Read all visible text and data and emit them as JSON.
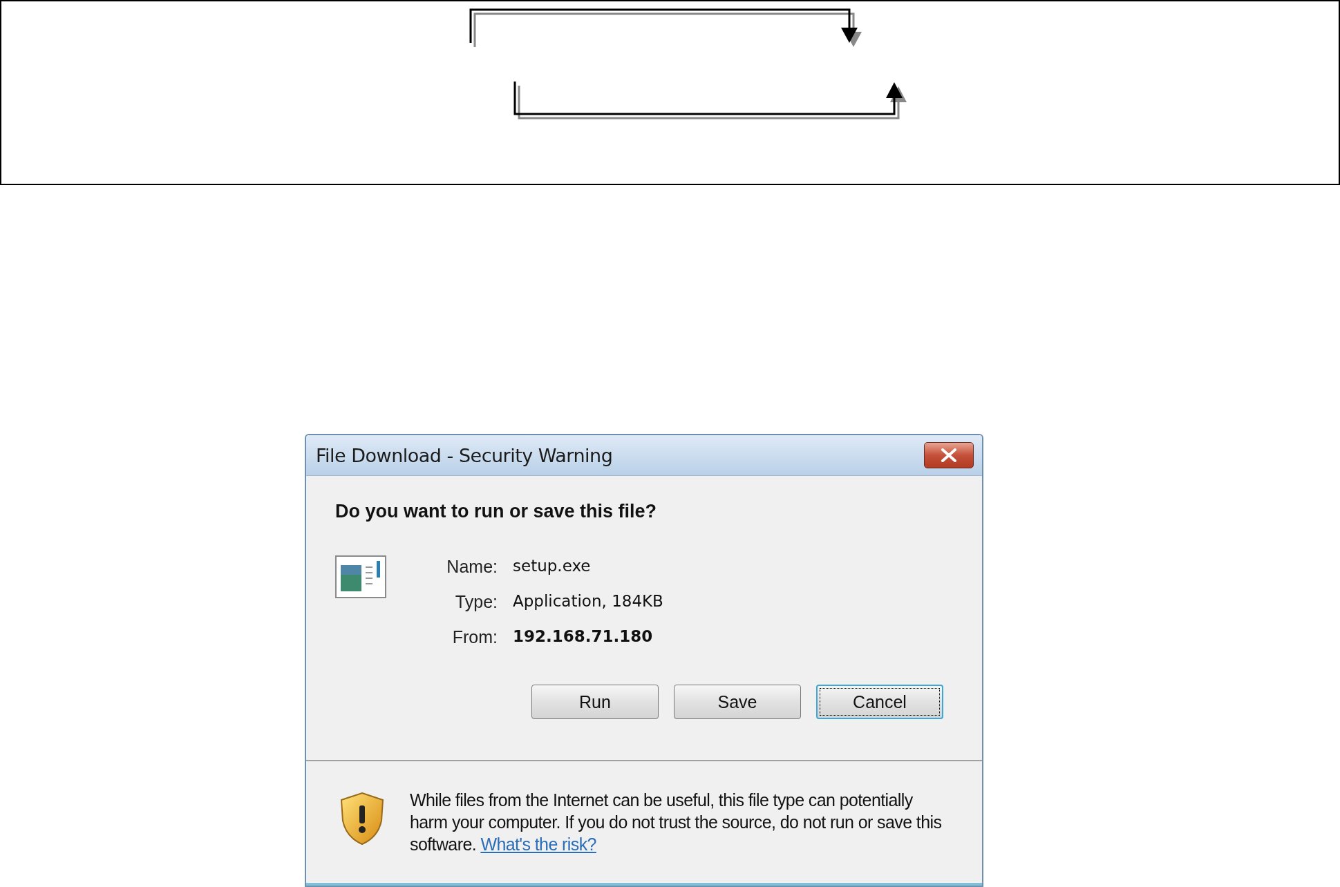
{
  "dialog": {
    "title": "File Download - Security Warning",
    "heading": "Do you want to run or save this file?",
    "details": [
      {
        "label": "Name:",
        "value": "setup.exe",
        "bold": false
      },
      {
        "label": "Type:",
        "value": "Application, 184KB",
        "bold": false
      },
      {
        "label": "From:",
        "value": "192.168.71.180",
        "bold": true
      }
    ],
    "buttons": [
      {
        "label": "Run",
        "focused": false
      },
      {
        "label": "Save",
        "focused": false
      },
      {
        "label": "Cancel",
        "focused": true
      }
    ],
    "warning": {
      "text": "While files from the Internet can be useful, this file type can potentially harm your computer. If you do not trust the source, do not run or save this software.",
      "link": "What's the risk?"
    }
  }
}
